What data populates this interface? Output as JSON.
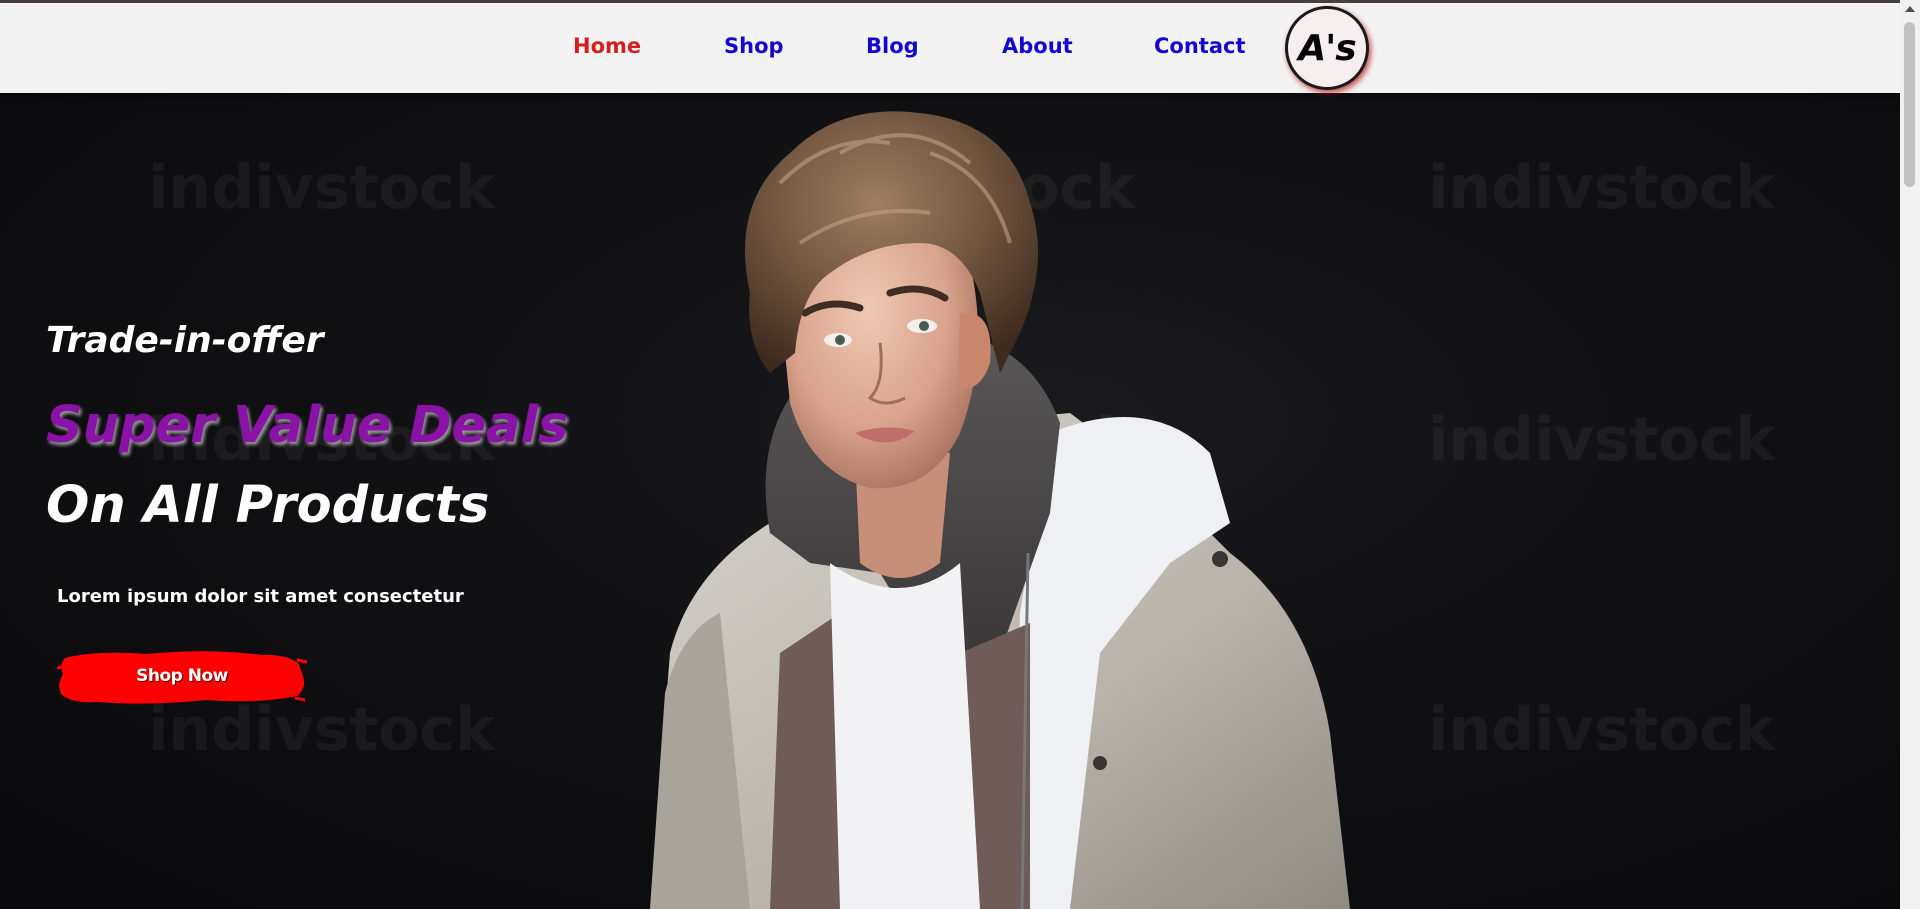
{
  "nav": {
    "items": [
      {
        "label": "Home",
        "active": true
      },
      {
        "label": "Shop",
        "active": false
      },
      {
        "label": "Blog",
        "active": false
      },
      {
        "label": "About",
        "active": false
      },
      {
        "label": "Contact",
        "active": false
      }
    ],
    "logo_text": "A's",
    "active_color": "#d41f1f",
    "link_color": "#1207cf"
  },
  "hero": {
    "watermark_text": "indivstock",
    "subtitle": "Trade-in-offer",
    "headline_1": "Super Value Deals",
    "headline_2": "On All Products",
    "description": "Lorem ipsum dolor sit amet consectetur",
    "cta_label": "Shop Now",
    "headline_1_color": "#8a12a6",
    "cta_color": "#ff0000"
  },
  "icons": {
    "logo": "circular-monogram-logo",
    "scroll_up": "triangle-up-icon"
  }
}
